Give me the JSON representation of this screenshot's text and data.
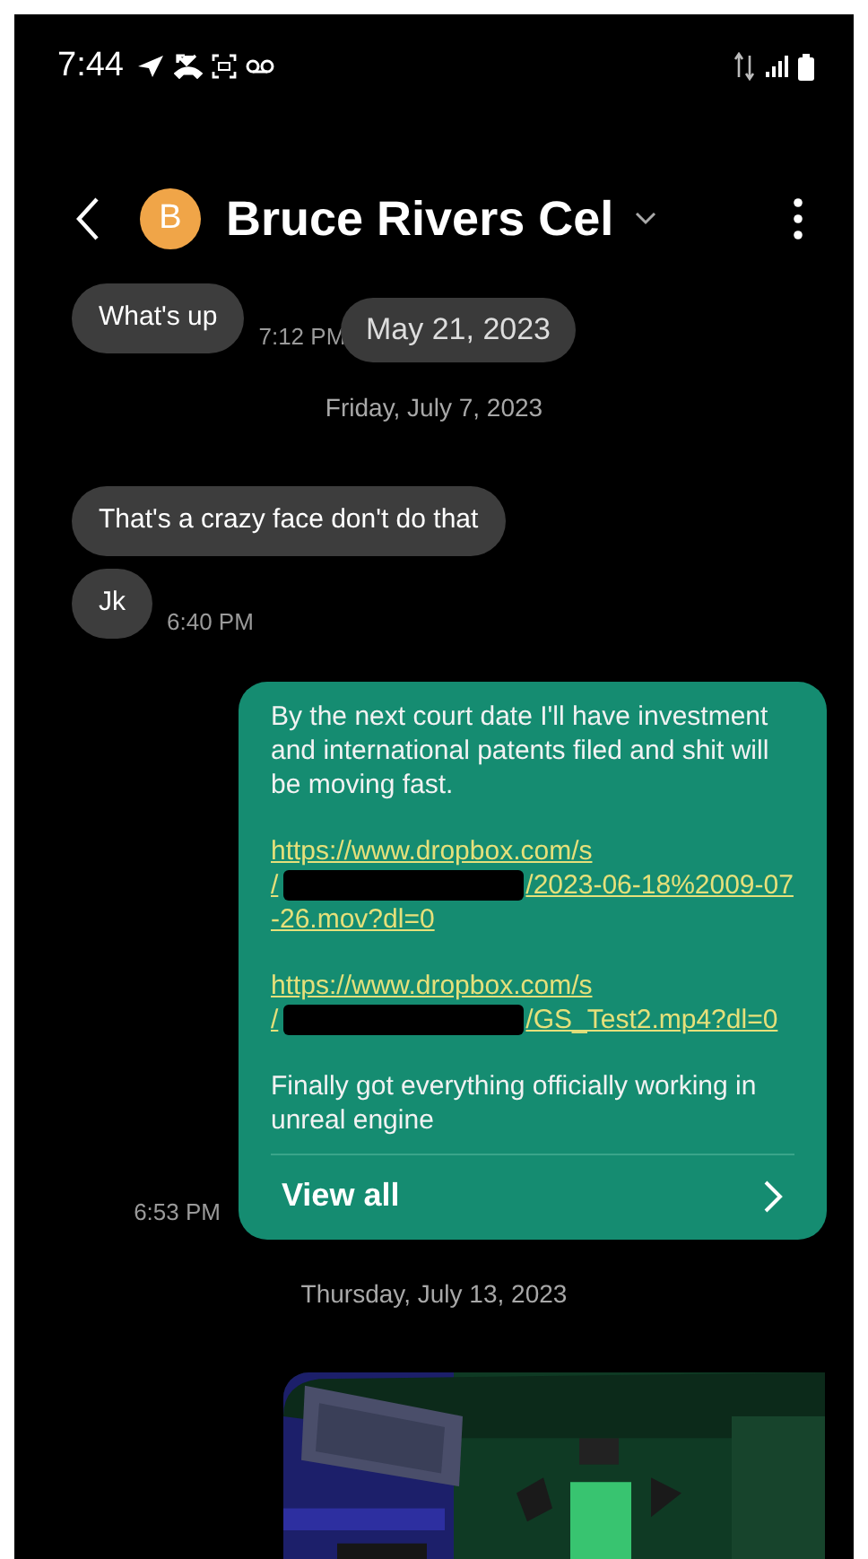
{
  "status_bar": {
    "time": "7:44"
  },
  "header": {
    "avatar_letter": "B",
    "contact": "Bruce Rivers Cel"
  },
  "floating_date": "May 21, 2023",
  "sections": [
    {
      "messages": [
        {
          "kind": "received",
          "text": "What's up",
          "time": "7:12 PM"
        }
      ]
    },
    {
      "date": "Friday, July 7, 2023",
      "messages": [
        {
          "kind": "received",
          "text": "That's a crazy face don't do that"
        },
        {
          "kind": "received",
          "text": "Jk",
          "time": "6:40 PM"
        }
      ]
    },
    {
      "messages": [
        {
          "kind": "sent_card",
          "time": "6:53 PM",
          "intro": "By the next court date I'll have investment and international patents filed and shit will be moving fast.",
          "links": [
            {
              "line1": "https://www.dropbox.com/s",
              "line2_start": "/",
              "line2_end": "/2023-06-18%2009-07",
              "line3": "-26.mov?dl=0"
            },
            {
              "line1": "https://www.dropbox.com/s",
              "line2_start": "/",
              "line2_end": "/GS_Test2.mp4?dl=0"
            }
          ],
          "outro": "Finally got everything officially working in unreal engine",
          "action": "View all"
        }
      ]
    },
    {
      "date": "Thursday, July 13, 2023"
    }
  ]
}
